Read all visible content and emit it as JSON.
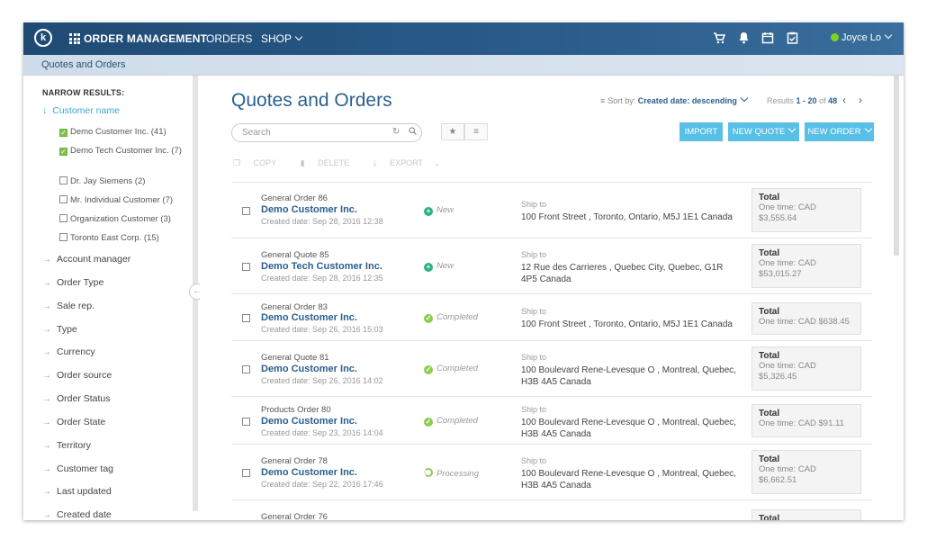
{
  "app": {
    "logo_letter": "k",
    "title": "ORDER MANAGEMENT",
    "nav": {
      "orders": "ORDERS",
      "shop": "SHOP"
    },
    "user": "Joyce Lo",
    "icons": [
      "cart-icon",
      "bell-icon",
      "calendar-icon",
      "clipboard-icon"
    ]
  },
  "breadcrumb": "Quotes and Orders",
  "sidebar": {
    "heading": "NARROW RESULTS:",
    "active_filter": "Customer name",
    "options": [
      {
        "label": "Demo Customer Inc. (41)",
        "checked": true
      },
      {
        "label": "Demo Tech Customer Inc. (7)",
        "checked": true
      },
      {
        "label": "Dr. Jay Siemens (2)",
        "checked": false
      },
      {
        "label": "Mr. Individual Customer (7)",
        "checked": false
      },
      {
        "label": "Organization Customer (3)",
        "checked": false
      },
      {
        "label": "Toronto East Corp. (15)",
        "checked": false
      }
    ],
    "filters": [
      "Account manager",
      "Order Type",
      "Sale rep.",
      "Type",
      "Currency",
      "Order source",
      "Order Status",
      "Order State",
      "Territory",
      "Customer tag",
      "Last updated",
      "Created date"
    ]
  },
  "main": {
    "title": "Quotes and Orders",
    "sort_prefix": "Sort by:",
    "sort_value": "Created date: descending",
    "results_prefix": "Results",
    "results_range": "1 - 20",
    "results_of": "of",
    "results_total": "48",
    "search_placeholder": "Search",
    "buttons": {
      "import": "IMPORT",
      "new_quote": "NEW QUOTE",
      "new_order": "NEW ORDER"
    },
    "actions": {
      "copy": "COPY",
      "delete": "DELETE",
      "export": "EXPORT"
    },
    "ship_label": "Ship to",
    "total_label": "Total",
    "orders": [
      {
        "name": "General Order 86",
        "customer": "Demo Customer Inc.",
        "created": "Created date: Sep 28, 2016 12:38",
        "status": "New",
        "status_type": "new",
        "address": "100 Front Street , Toronto, Ontario, M5J 1E1 Canada",
        "total_line1": "One time: CAD",
        "total_line2": "$3,555.64"
      },
      {
        "name": "General Quote 85",
        "customer": "Demo Tech Customer Inc.",
        "created": "Created date: Sep 28, 2016 12:35",
        "status": "New",
        "status_type": "new",
        "address": "12 Rue des Carrieres , Quebec City, Quebec, G1R 4P5 Canada",
        "total_line1": "One time: CAD",
        "total_line2": "$53,015.27"
      },
      {
        "name": "General Order 83",
        "customer": "Demo Customer Inc.",
        "created": "Created date: Sep 26, 2016 15:03",
        "status": "Completed",
        "status_type": "done",
        "address": "100 Front Street , Toronto, Ontario, M5J 1E1 Canada",
        "total_line1": "One time: CAD $638.45",
        "total_line2": ""
      },
      {
        "name": "General Quote 81",
        "customer": "Demo Customer Inc.",
        "created": "Created date: Sep 26, 2016 14:02",
        "status": "Completed",
        "status_type": "done",
        "address": "100 Boulevard Rene-Levesque O , Montreal, Quebec, H3B 4A5 Canada",
        "total_line1": "One time: CAD",
        "total_line2": "$5,326.45"
      },
      {
        "name": "Products Order 80",
        "customer": "Demo Customer Inc.",
        "created": "Created date: Sep 23, 2016 14:04",
        "status": "Completed",
        "status_type": "done",
        "address": "100 Boulevard Rene-Levesque O , Montreal, Quebec, H3B 4A5 Canada",
        "total_line1": "One time: CAD $91.11",
        "total_line2": ""
      },
      {
        "name": "General Order 78",
        "customer": "Demo Customer Inc.",
        "created": "Created date: Sep 22, 2016 17:46",
        "status": "Processing",
        "status_type": "proc",
        "address": "100 Boulevard Rene-Levesque O , Montreal, Quebec, H3B 4A5 Canada",
        "total_line1": "One time: CAD",
        "total_line2": "$6,662.51"
      },
      {
        "name": "General Order 76",
        "customer": "",
        "created": "",
        "status": "",
        "status_type": "",
        "address": "",
        "total_line1": "",
        "total_line2": ""
      }
    ]
  }
}
